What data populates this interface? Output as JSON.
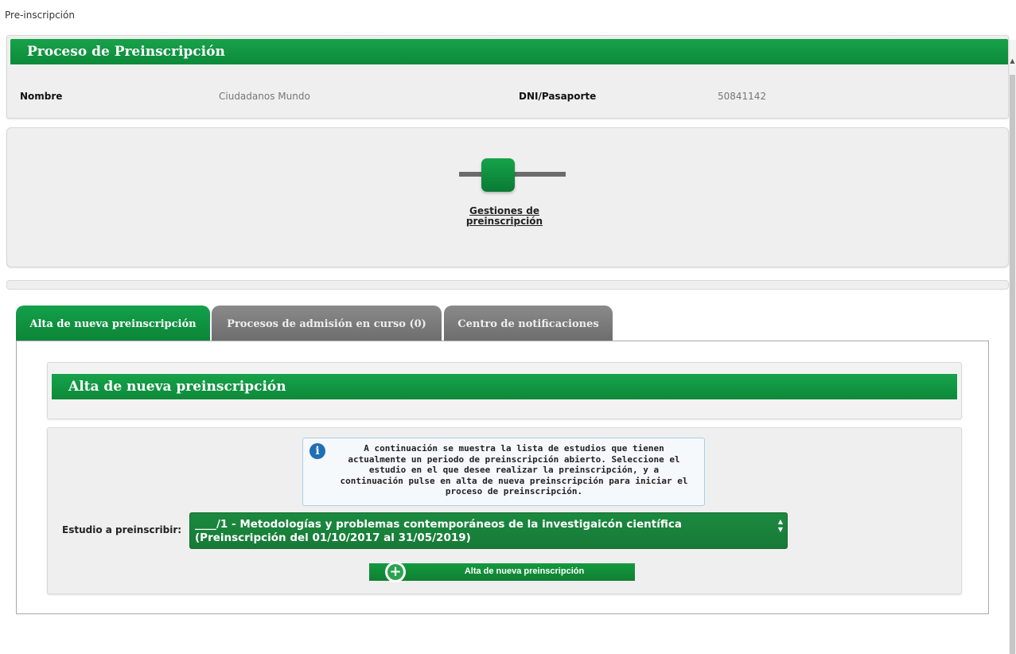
{
  "page": {
    "title": "Pre-inscripción"
  },
  "proceso": {
    "header": "Proceso de Preinscripción",
    "nombre_label": "Nombre",
    "nombre_value": "Ciudadanos Mundo",
    "dni_label": "DNI/Pasaporte",
    "dni_value": "50841142"
  },
  "steps": {
    "link_label": "Gestiones de preinscripción"
  },
  "tabs": [
    {
      "label": "Alta de nueva preinscripción",
      "active": true
    },
    {
      "label": "Procesos de admisión en curso (0)",
      "active": false
    },
    {
      "label": "Centro de notificaciones",
      "active": false
    }
  ],
  "alta": {
    "header": "Alta de nueva preinscripción",
    "info_text": "A continuación se muestra la lista de estudios que tienen actualmente un periodo de preinscripción abierto. Seleccione el estudio en el que desee realizar la preinscripción, y a continuación pulse en alta de nueva preinscripción para iniciar el proceso de preinscripción.",
    "estudio_label": "Estudio a preinscribir:",
    "estudio_selected": "____/1 - Metodologías y problemas contemporáneos de la investigaicón científica\n(Preinscripción del 01/10/2017 al 31/05/2019)",
    "button_label": "Alta de nueva preinscripción"
  },
  "colors": {
    "accent": "#0f8f3d",
    "tab_inactive": "#7a7a7a"
  }
}
